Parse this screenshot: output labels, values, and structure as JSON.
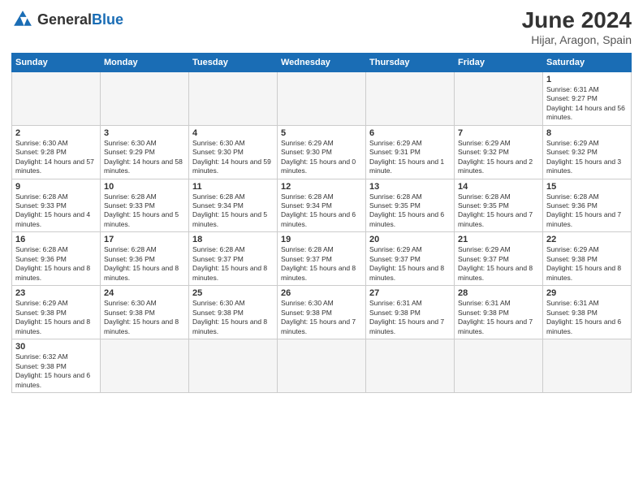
{
  "header": {
    "logo_general": "General",
    "logo_blue": "Blue",
    "title": "June 2024",
    "subtitle": "Hijar, Aragon, Spain"
  },
  "days_of_week": [
    "Sunday",
    "Monday",
    "Tuesday",
    "Wednesday",
    "Thursday",
    "Friday",
    "Saturday"
  ],
  "weeks": [
    [
      {
        "day": "",
        "info": ""
      },
      {
        "day": "",
        "info": ""
      },
      {
        "day": "",
        "info": ""
      },
      {
        "day": "",
        "info": ""
      },
      {
        "day": "",
        "info": ""
      },
      {
        "day": "",
        "info": ""
      },
      {
        "day": "1",
        "info": "Sunrise: 6:31 AM\nSunset: 9:27 PM\nDaylight: 14 hours and 56 minutes."
      }
    ],
    [
      {
        "day": "2",
        "info": "Sunrise: 6:30 AM\nSunset: 9:28 PM\nDaylight: 14 hours and 57 minutes."
      },
      {
        "day": "3",
        "info": "Sunrise: 6:30 AM\nSunset: 9:29 PM\nDaylight: 14 hours and 58 minutes."
      },
      {
        "day": "4",
        "info": "Sunrise: 6:30 AM\nSunset: 9:30 PM\nDaylight: 14 hours and 59 minutes."
      },
      {
        "day": "5",
        "info": "Sunrise: 6:29 AM\nSunset: 9:30 PM\nDaylight: 15 hours and 0 minutes."
      },
      {
        "day": "6",
        "info": "Sunrise: 6:29 AM\nSunset: 9:31 PM\nDaylight: 15 hours and 1 minute."
      },
      {
        "day": "7",
        "info": "Sunrise: 6:29 AM\nSunset: 9:32 PM\nDaylight: 15 hours and 2 minutes."
      },
      {
        "day": "8",
        "info": "Sunrise: 6:29 AM\nSunset: 9:32 PM\nDaylight: 15 hours and 3 minutes."
      }
    ],
    [
      {
        "day": "9",
        "info": "Sunrise: 6:28 AM\nSunset: 9:33 PM\nDaylight: 15 hours and 4 minutes."
      },
      {
        "day": "10",
        "info": "Sunrise: 6:28 AM\nSunset: 9:33 PM\nDaylight: 15 hours and 5 minutes."
      },
      {
        "day": "11",
        "info": "Sunrise: 6:28 AM\nSunset: 9:34 PM\nDaylight: 15 hours and 5 minutes."
      },
      {
        "day": "12",
        "info": "Sunrise: 6:28 AM\nSunset: 9:34 PM\nDaylight: 15 hours and 6 minutes."
      },
      {
        "day": "13",
        "info": "Sunrise: 6:28 AM\nSunset: 9:35 PM\nDaylight: 15 hours and 6 minutes."
      },
      {
        "day": "14",
        "info": "Sunrise: 6:28 AM\nSunset: 9:35 PM\nDaylight: 15 hours and 7 minutes."
      },
      {
        "day": "15",
        "info": "Sunrise: 6:28 AM\nSunset: 9:36 PM\nDaylight: 15 hours and 7 minutes."
      }
    ],
    [
      {
        "day": "16",
        "info": "Sunrise: 6:28 AM\nSunset: 9:36 PM\nDaylight: 15 hours and 8 minutes."
      },
      {
        "day": "17",
        "info": "Sunrise: 6:28 AM\nSunset: 9:36 PM\nDaylight: 15 hours and 8 minutes."
      },
      {
        "day": "18",
        "info": "Sunrise: 6:28 AM\nSunset: 9:37 PM\nDaylight: 15 hours and 8 minutes."
      },
      {
        "day": "19",
        "info": "Sunrise: 6:28 AM\nSunset: 9:37 PM\nDaylight: 15 hours and 8 minutes."
      },
      {
        "day": "20",
        "info": "Sunrise: 6:29 AM\nSunset: 9:37 PM\nDaylight: 15 hours and 8 minutes."
      },
      {
        "day": "21",
        "info": "Sunrise: 6:29 AM\nSunset: 9:37 PM\nDaylight: 15 hours and 8 minutes."
      },
      {
        "day": "22",
        "info": "Sunrise: 6:29 AM\nSunset: 9:38 PM\nDaylight: 15 hours and 8 minutes."
      }
    ],
    [
      {
        "day": "23",
        "info": "Sunrise: 6:29 AM\nSunset: 9:38 PM\nDaylight: 15 hours and 8 minutes."
      },
      {
        "day": "24",
        "info": "Sunrise: 6:30 AM\nSunset: 9:38 PM\nDaylight: 15 hours and 8 minutes."
      },
      {
        "day": "25",
        "info": "Sunrise: 6:30 AM\nSunset: 9:38 PM\nDaylight: 15 hours and 8 minutes."
      },
      {
        "day": "26",
        "info": "Sunrise: 6:30 AM\nSunset: 9:38 PM\nDaylight: 15 hours and 7 minutes."
      },
      {
        "day": "27",
        "info": "Sunrise: 6:31 AM\nSunset: 9:38 PM\nDaylight: 15 hours and 7 minutes."
      },
      {
        "day": "28",
        "info": "Sunrise: 6:31 AM\nSunset: 9:38 PM\nDaylight: 15 hours and 7 minutes."
      },
      {
        "day": "29",
        "info": "Sunrise: 6:31 AM\nSunset: 9:38 PM\nDaylight: 15 hours and 6 minutes."
      }
    ],
    [
      {
        "day": "30",
        "info": "Sunrise: 6:32 AM\nSunset: 9:38 PM\nDaylight: 15 hours and 6 minutes."
      },
      {
        "day": "",
        "info": ""
      },
      {
        "day": "",
        "info": ""
      },
      {
        "day": "",
        "info": ""
      },
      {
        "day": "",
        "info": ""
      },
      {
        "day": "",
        "info": ""
      },
      {
        "day": "",
        "info": ""
      }
    ]
  ]
}
